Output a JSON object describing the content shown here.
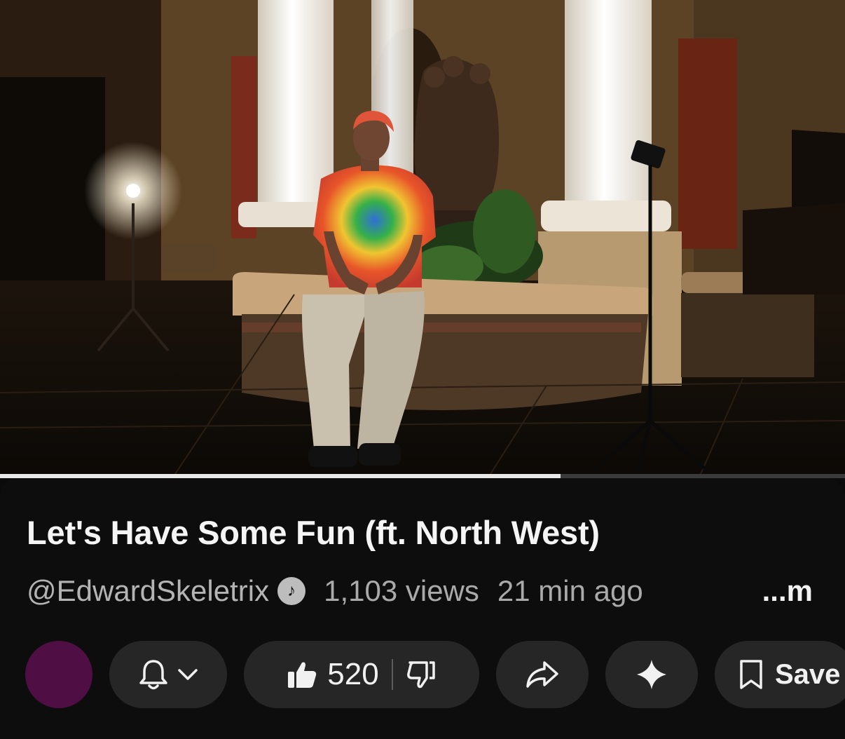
{
  "video": {
    "progress_fraction": 0.663
  },
  "title": "Let's Have Some Fun (ft. North West)",
  "meta": {
    "channel": "@EdwardSkeletrix",
    "verified_icon": "music-note-badge-icon",
    "views": "1,103 views",
    "age": "21 min ago",
    "more": "...m"
  },
  "actions": {
    "avatar_color": "#4f0f44",
    "subscribe_icon": "bell-icon",
    "dropdown_icon": "chevron-down-icon",
    "like_count": "520",
    "like_icon": "thumbs-up-icon",
    "dislike_icon": "thumbs-down-icon",
    "share_icon": "share-arrow-icon",
    "remix_icon": "sparkle-icon",
    "save_label": "Save",
    "save_icon": "bookmark-icon"
  }
}
